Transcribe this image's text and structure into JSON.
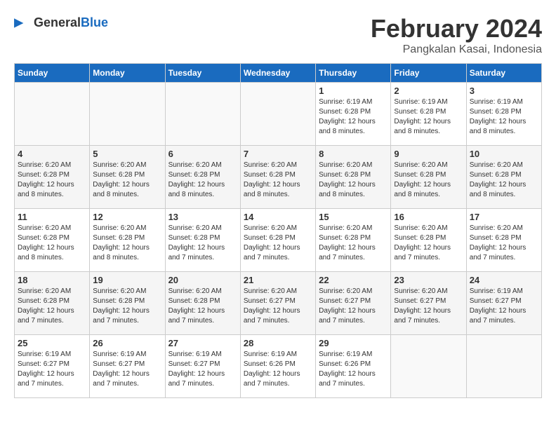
{
  "logo": {
    "general": "General",
    "blue": "Blue"
  },
  "header": {
    "month_year": "February 2024",
    "location": "Pangkalan Kasai, Indonesia"
  },
  "days_of_week": [
    "Sunday",
    "Monday",
    "Tuesday",
    "Wednesday",
    "Thursday",
    "Friday",
    "Saturday"
  ],
  "weeks": [
    [
      {
        "day": "",
        "info": ""
      },
      {
        "day": "",
        "info": ""
      },
      {
        "day": "",
        "info": ""
      },
      {
        "day": "",
        "info": ""
      },
      {
        "day": "1",
        "info": "Sunrise: 6:19 AM\nSunset: 6:28 PM\nDaylight: 12 hours\nand 8 minutes."
      },
      {
        "day": "2",
        "info": "Sunrise: 6:19 AM\nSunset: 6:28 PM\nDaylight: 12 hours\nand 8 minutes."
      },
      {
        "day": "3",
        "info": "Sunrise: 6:19 AM\nSunset: 6:28 PM\nDaylight: 12 hours\nand 8 minutes."
      }
    ],
    [
      {
        "day": "4",
        "info": "Sunrise: 6:20 AM\nSunset: 6:28 PM\nDaylight: 12 hours\nand 8 minutes."
      },
      {
        "day": "5",
        "info": "Sunrise: 6:20 AM\nSunset: 6:28 PM\nDaylight: 12 hours\nand 8 minutes."
      },
      {
        "day": "6",
        "info": "Sunrise: 6:20 AM\nSunset: 6:28 PM\nDaylight: 12 hours\nand 8 minutes."
      },
      {
        "day": "7",
        "info": "Sunrise: 6:20 AM\nSunset: 6:28 PM\nDaylight: 12 hours\nand 8 minutes."
      },
      {
        "day": "8",
        "info": "Sunrise: 6:20 AM\nSunset: 6:28 PM\nDaylight: 12 hours\nand 8 minutes."
      },
      {
        "day": "9",
        "info": "Sunrise: 6:20 AM\nSunset: 6:28 PM\nDaylight: 12 hours\nand 8 minutes."
      },
      {
        "day": "10",
        "info": "Sunrise: 6:20 AM\nSunset: 6:28 PM\nDaylight: 12 hours\nand 8 minutes."
      }
    ],
    [
      {
        "day": "11",
        "info": "Sunrise: 6:20 AM\nSunset: 6:28 PM\nDaylight: 12 hours\nand 8 minutes."
      },
      {
        "day": "12",
        "info": "Sunrise: 6:20 AM\nSunset: 6:28 PM\nDaylight: 12 hours\nand 8 minutes."
      },
      {
        "day": "13",
        "info": "Sunrise: 6:20 AM\nSunset: 6:28 PM\nDaylight: 12 hours\nand 7 minutes."
      },
      {
        "day": "14",
        "info": "Sunrise: 6:20 AM\nSunset: 6:28 PM\nDaylight: 12 hours\nand 7 minutes."
      },
      {
        "day": "15",
        "info": "Sunrise: 6:20 AM\nSunset: 6:28 PM\nDaylight: 12 hours\nand 7 minutes."
      },
      {
        "day": "16",
        "info": "Sunrise: 6:20 AM\nSunset: 6:28 PM\nDaylight: 12 hours\nand 7 minutes."
      },
      {
        "day": "17",
        "info": "Sunrise: 6:20 AM\nSunset: 6:28 PM\nDaylight: 12 hours\nand 7 minutes."
      }
    ],
    [
      {
        "day": "18",
        "info": "Sunrise: 6:20 AM\nSunset: 6:28 PM\nDaylight: 12 hours\nand 7 minutes."
      },
      {
        "day": "19",
        "info": "Sunrise: 6:20 AM\nSunset: 6:28 PM\nDaylight: 12 hours\nand 7 minutes."
      },
      {
        "day": "20",
        "info": "Sunrise: 6:20 AM\nSunset: 6:28 PM\nDaylight: 12 hours\nand 7 minutes."
      },
      {
        "day": "21",
        "info": "Sunrise: 6:20 AM\nSunset: 6:27 PM\nDaylight: 12 hours\nand 7 minutes."
      },
      {
        "day": "22",
        "info": "Sunrise: 6:20 AM\nSunset: 6:27 PM\nDaylight: 12 hours\nand 7 minutes."
      },
      {
        "day": "23",
        "info": "Sunrise: 6:20 AM\nSunset: 6:27 PM\nDaylight: 12 hours\nand 7 minutes."
      },
      {
        "day": "24",
        "info": "Sunrise: 6:19 AM\nSunset: 6:27 PM\nDaylight: 12 hours\nand 7 minutes."
      }
    ],
    [
      {
        "day": "25",
        "info": "Sunrise: 6:19 AM\nSunset: 6:27 PM\nDaylight: 12 hours\nand 7 minutes."
      },
      {
        "day": "26",
        "info": "Sunrise: 6:19 AM\nSunset: 6:27 PM\nDaylight: 12 hours\nand 7 minutes."
      },
      {
        "day": "27",
        "info": "Sunrise: 6:19 AM\nSunset: 6:27 PM\nDaylight: 12 hours\nand 7 minutes."
      },
      {
        "day": "28",
        "info": "Sunrise: 6:19 AM\nSunset: 6:26 PM\nDaylight: 12 hours\nand 7 minutes."
      },
      {
        "day": "29",
        "info": "Sunrise: 6:19 AM\nSunset: 6:26 PM\nDaylight: 12 hours\nand 7 minutes."
      },
      {
        "day": "",
        "info": ""
      },
      {
        "day": "",
        "info": ""
      }
    ]
  ]
}
